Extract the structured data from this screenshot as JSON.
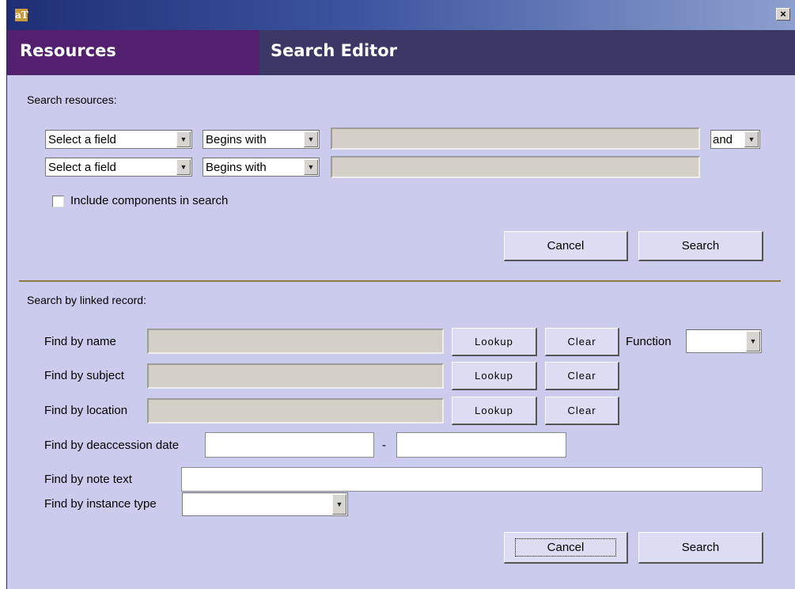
{
  "window": {
    "app_icon": "aT",
    "close_label": "×"
  },
  "header": {
    "left_title": "Resources",
    "right_title": "Search Editor"
  },
  "search_resources": {
    "section_label": "Search resources:",
    "rows": [
      {
        "field": "Select a field",
        "operator": "Begins with",
        "value": "",
        "conjunction": "and"
      },
      {
        "field": "Select a field",
        "operator": "Begins with",
        "value": ""
      }
    ],
    "include_components_label": "Include components in search",
    "include_components_checked": false,
    "cancel_label": "Cancel",
    "search_label": "Search"
  },
  "linked_record": {
    "section_label": "Search by linked record:",
    "name_label": "Find by name",
    "subject_label": "Find by subject",
    "location_label": "Find by location",
    "lookup_label": "Lookup",
    "clear_label": "Clear",
    "function_label": "Function",
    "function_value": "",
    "deaccession_label": "Find by deaccession date",
    "date_separator": "-",
    "note_label": "Find by note text",
    "instance_label": "Find by instance type",
    "instance_value": "",
    "cancel_label": "Cancel",
    "search_label": "Search"
  }
}
